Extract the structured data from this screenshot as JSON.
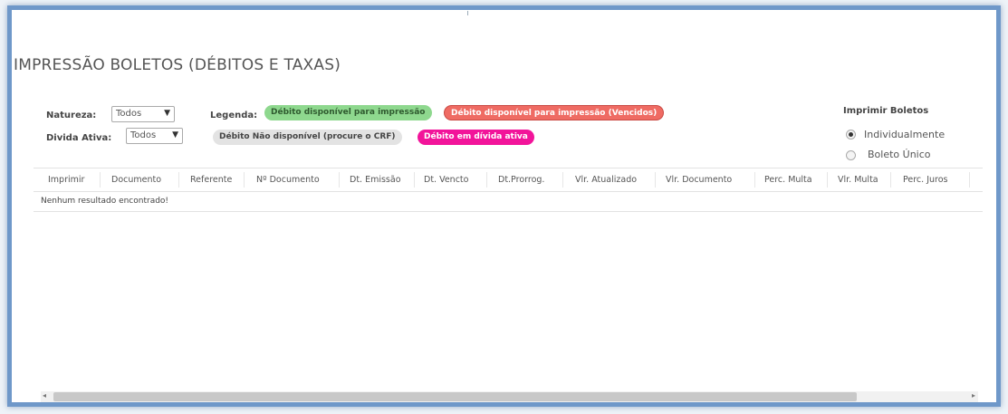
{
  "page": {
    "title": "IMPRESSÃO BOLETOS (DÉBITOS E TAXAS)"
  },
  "filters": {
    "natureza_label": "Natureza:",
    "natureza_value": "Todos",
    "divida_label": "Divida Ativa:",
    "divida_value": "Todos"
  },
  "legend": {
    "label": "Legenda:",
    "items": [
      {
        "text": "Débito disponível para impressão",
        "color": "#8ed88e"
      },
      {
        "text": "Débito disponível para impressão (Vencidos)",
        "color": "#ef6b63"
      },
      {
        "text": "Débito Não disponível (procure o CRF)",
        "color": "#e3e3e3"
      },
      {
        "text": "Débito em dívida ativa",
        "color": "#f2149a"
      }
    ]
  },
  "print": {
    "title": "Imprimir Boletos",
    "options": [
      {
        "label": "Individualmente",
        "selected": true
      },
      {
        "label": "Boleto Único",
        "selected": false
      }
    ]
  },
  "table": {
    "columns": [
      "Imprimir",
      "Documento",
      "Referente",
      "Nº Documento",
      "Dt. Emissão",
      "Dt. Vencto",
      "Dt.Prorrog.",
      "Vlr. Atualizado",
      "Vlr. Documento",
      "Perc. Multa",
      "Vlr. Multa",
      "Perc. Juros"
    ],
    "empty_message": "Nenhum resultado encontrado!"
  },
  "scrollbar": {
    "left_arrow": "◂",
    "right_arrow": "▸"
  }
}
